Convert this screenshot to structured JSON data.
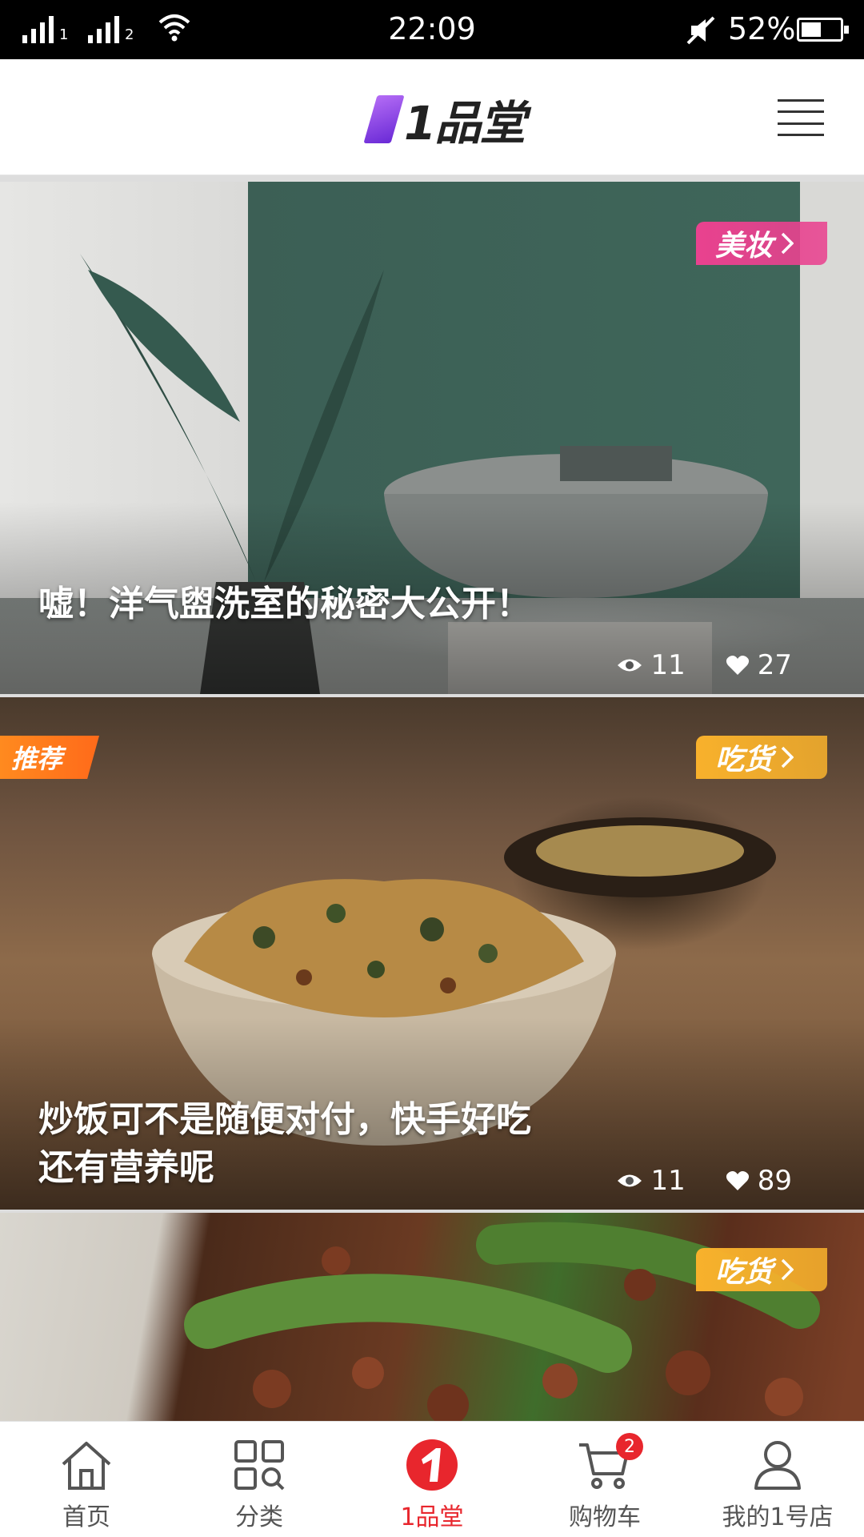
{
  "status_bar": {
    "sim1": "1",
    "sim2": "2",
    "time": "22:09",
    "battery_percent": "52%",
    "battery_level": 0.52
  },
  "header": {
    "logo_text": "1品堂"
  },
  "cards": [
    {
      "tag": "美妆",
      "tag_color": "#e9428f",
      "title": "嘘！洋气盥洗室的秘密大公开！",
      "views": "11",
      "likes": "27"
    },
    {
      "badge": "推荐",
      "tag": "吃货",
      "tag_color": "#f8b12c",
      "title": "炒饭可不是随便对付，快手好吃还有营养呢",
      "views": "11",
      "likes": "89"
    },
    {
      "tag": "吃货",
      "tag_color": "#f8b12c"
    }
  ],
  "tabbar": {
    "items": [
      {
        "label": "首页",
        "icon": "home-icon"
      },
      {
        "label": "分类",
        "icon": "category-icon"
      },
      {
        "label": "1品堂",
        "icon": "brand-icon",
        "active": true
      },
      {
        "label": "购物车",
        "icon": "cart-icon",
        "badge": "2"
      },
      {
        "label": "我的1号店",
        "icon": "profile-icon"
      }
    ]
  },
  "colors": {
    "accent": "#e8262d",
    "recommend": "#ff7a1f"
  }
}
